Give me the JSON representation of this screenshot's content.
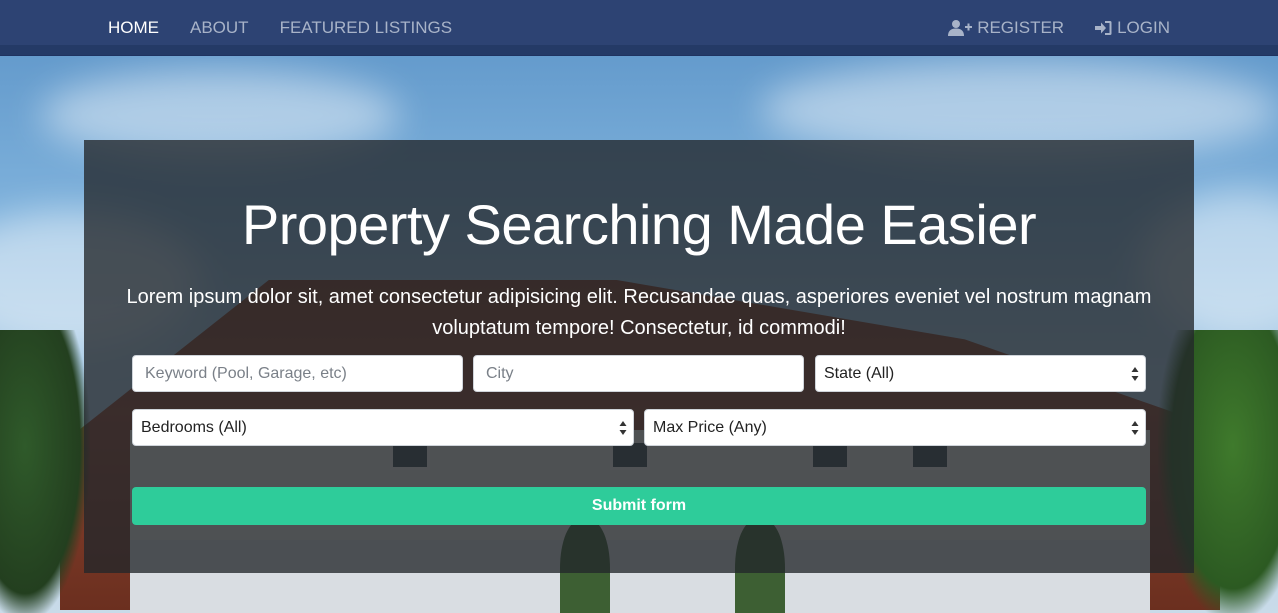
{
  "nav": {
    "home": "HOME",
    "about": "ABOUT",
    "featured": "FEATURED LISTINGS",
    "register": "REGISTER",
    "login": "LOGIN",
    "register_icon": "user-plus-icon",
    "login_icon": "sign-in-icon"
  },
  "hero": {
    "title": "Property Searching Made Easier",
    "text": "Lorem ipsum dolor sit, amet consectetur adipisicing elit. Recusandae quas, asperiores eveniet vel nostrum magnam voluptatum tempore! Consectetur, id commodi!"
  },
  "search": {
    "keyword_placeholder": "Keyword (Pool, Garage, etc)",
    "city_placeholder": "City",
    "state_value": "State (All)",
    "bedrooms_value": "Bedrooms (All)",
    "max_price_value": "Max Price (Any)",
    "submit_label": "Submit form"
  },
  "colors": {
    "navbar": "#2d4373",
    "submit": "#2ecc9a"
  }
}
